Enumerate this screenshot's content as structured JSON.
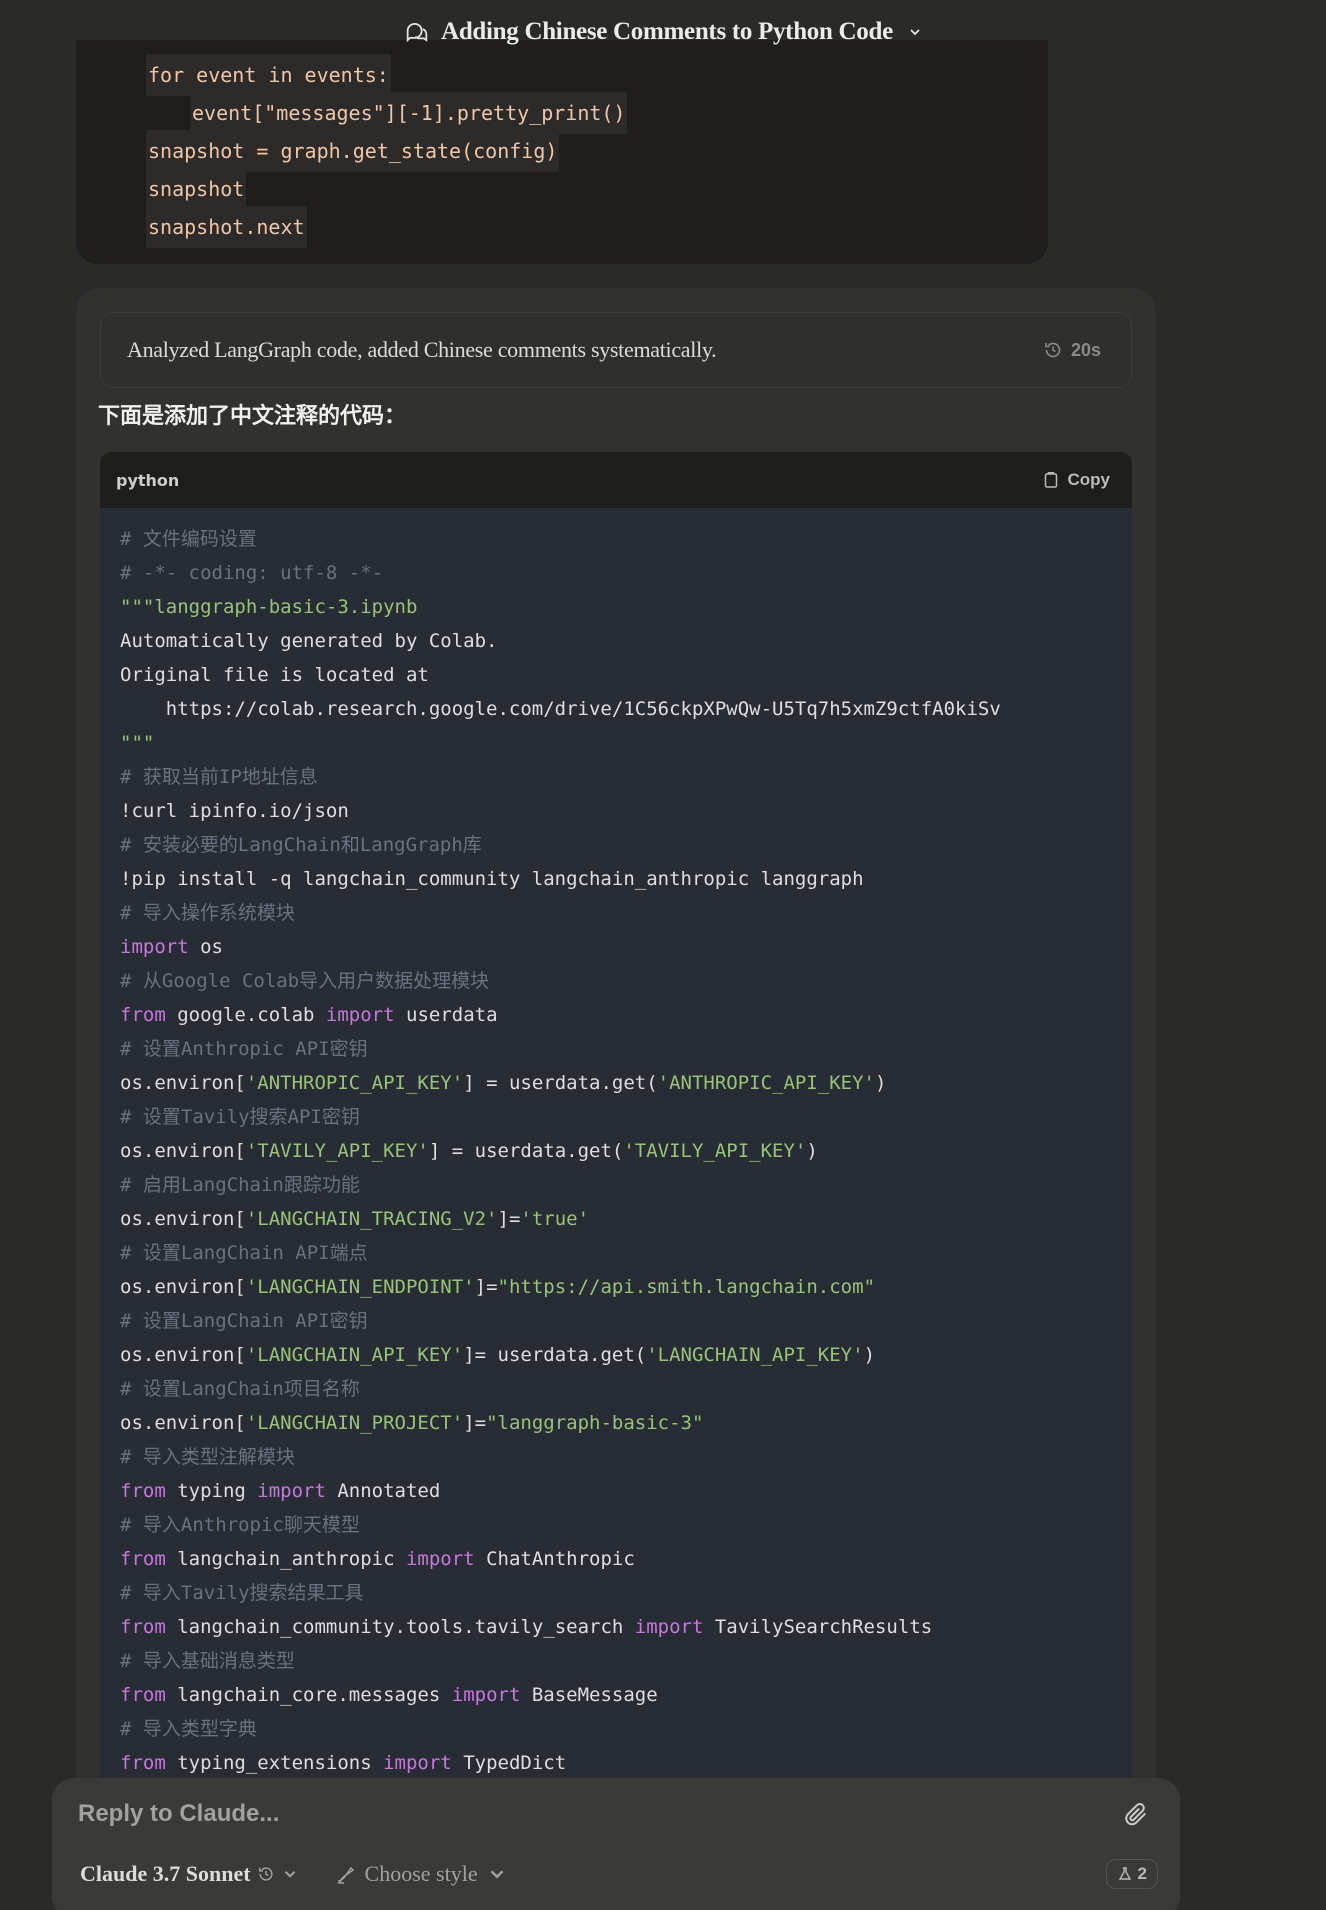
{
  "header": {
    "title": "Adding Chinese Comments to Python Code"
  },
  "previous_code": {
    "lines": [
      {
        "text": "for event in events:",
        "indent": 0
      },
      {
        "text": "event[\"messages\"][-1].pretty_print()",
        "indent": 1
      },
      {
        "text": "snapshot = graph.get_state(config)",
        "indent": 0
      },
      {
        "text": "snapshot",
        "indent": 0
      },
      {
        "text": "snapshot.next",
        "indent": 0
      }
    ]
  },
  "assistant": {
    "thinking_summary": "Analyzed LangGraph code, added Chinese comments systematically.",
    "thinking_duration": "20s",
    "intro": "下面是添加了中文注释的代码：",
    "code": {
      "language": "python",
      "copy_label": "Copy",
      "lines": [
        [
          {
            "t": "# 文件编码设置",
            "c": "com"
          }
        ],
        [
          {
            "t": "# -*- coding: utf-8 -*-",
            "c": "com"
          }
        ],
        [
          {
            "t": "\"\"\"langgraph-basic-3.ipynb",
            "c": "str"
          }
        ],
        [
          {
            "t": "Automatically generated by Colab.",
            "c": "def"
          }
        ],
        [
          {
            "t": "Original file is located at",
            "c": "def"
          }
        ],
        [
          {
            "t": "    https://colab.research.google.com/drive/1C56ckpXPwQw-U5Tq7h5xmZ9ctfA0kiSv",
            "c": "def"
          }
        ],
        [
          {
            "t": "\"\"\"",
            "c": "str"
          }
        ],
        [
          {
            "t": "# 获取当前IP地址信息",
            "c": "com"
          }
        ],
        [
          {
            "t": "!curl ipinfo.io/json",
            "c": "def"
          }
        ],
        [
          {
            "t": "# 安装必要的LangChain和LangGraph库",
            "c": "com"
          }
        ],
        [
          {
            "t": "!pip install -q langchain_community langchain_anthropic langgraph",
            "c": "def"
          }
        ],
        [
          {
            "t": "# 导入操作系统模块",
            "c": "com"
          }
        ],
        [
          {
            "t": "import",
            "c": "kw"
          },
          {
            "t": " os",
            "c": "def"
          }
        ],
        [
          {
            "t": "# 从Google Colab导入用户数据处理模块",
            "c": "com"
          }
        ],
        [
          {
            "t": "from",
            "c": "kw"
          },
          {
            "t": " google.colab ",
            "c": "def"
          },
          {
            "t": "import",
            "c": "kw"
          },
          {
            "t": " userdata",
            "c": "def"
          }
        ],
        [
          {
            "t": "# 设置Anthropic API密钥",
            "c": "com"
          }
        ],
        [
          {
            "t": "os.environ[",
            "c": "def"
          },
          {
            "t": "'ANTHROPIC_API_KEY'",
            "c": "str"
          },
          {
            "t": "] = userdata.get(",
            "c": "def"
          },
          {
            "t": "'ANTHROPIC_API_KEY'",
            "c": "str"
          },
          {
            "t": ")",
            "c": "def"
          }
        ],
        [
          {
            "t": "# 设置Tavily搜索API密钥",
            "c": "com"
          }
        ],
        [
          {
            "t": "os.environ[",
            "c": "def"
          },
          {
            "t": "'TAVILY_API_KEY'",
            "c": "str"
          },
          {
            "t": "] = userdata.get(",
            "c": "def"
          },
          {
            "t": "'TAVILY_API_KEY'",
            "c": "str"
          },
          {
            "t": ")",
            "c": "def"
          }
        ],
        [
          {
            "t": "# 启用LangChain跟踪功能",
            "c": "com"
          }
        ],
        [
          {
            "t": "os.environ[",
            "c": "def"
          },
          {
            "t": "'LANGCHAIN_TRACING_V2'",
            "c": "str"
          },
          {
            "t": "]=",
            "c": "def"
          },
          {
            "t": "'true'",
            "c": "str"
          }
        ],
        [
          {
            "t": "# 设置LangChain API端点",
            "c": "com"
          }
        ],
        [
          {
            "t": "os.environ[",
            "c": "def"
          },
          {
            "t": "'LANGCHAIN_ENDPOINT'",
            "c": "str"
          },
          {
            "t": "]=",
            "c": "def"
          },
          {
            "t": "\"https://api.smith.langchain.com\"",
            "c": "str"
          }
        ],
        [
          {
            "t": "# 设置LangChain API密钥",
            "c": "com"
          }
        ],
        [
          {
            "t": "os.environ[",
            "c": "def"
          },
          {
            "t": "'LANGCHAIN_API_KEY'",
            "c": "str"
          },
          {
            "t": "]= userdata.get(",
            "c": "def"
          },
          {
            "t": "'LANGCHAIN_API_KEY'",
            "c": "str"
          },
          {
            "t": ")",
            "c": "def"
          }
        ],
        [
          {
            "t": "# 设置LangChain项目名称",
            "c": "com"
          }
        ],
        [
          {
            "t": "os.environ[",
            "c": "def"
          },
          {
            "t": "'LANGCHAIN_PROJECT'",
            "c": "str"
          },
          {
            "t": "]=",
            "c": "def"
          },
          {
            "t": "\"langgraph-basic-3\"",
            "c": "str"
          }
        ],
        [
          {
            "t": "# 导入类型注解模块",
            "c": "com"
          }
        ],
        [
          {
            "t": "from",
            "c": "kw"
          },
          {
            "t": " typing ",
            "c": "def"
          },
          {
            "t": "import",
            "c": "kw"
          },
          {
            "t": " Annotated",
            "c": "def"
          }
        ],
        [
          {
            "t": "# 导入Anthropic聊天模型",
            "c": "com"
          }
        ],
        [
          {
            "t": "from",
            "c": "kw"
          },
          {
            "t": " langchain_anthropic ",
            "c": "def"
          },
          {
            "t": "import",
            "c": "kw"
          },
          {
            "t": " ChatAnthropic",
            "c": "def"
          }
        ],
        [
          {
            "t": "# 导入Tavily搜索结果工具",
            "c": "com"
          }
        ],
        [
          {
            "t": "from",
            "c": "kw"
          },
          {
            "t": " langchain_community.tools.tavily_search ",
            "c": "def"
          },
          {
            "t": "import",
            "c": "kw"
          },
          {
            "t": " TavilySearchResults",
            "c": "def"
          }
        ],
        [
          {
            "t": "# 导入基础消息类型",
            "c": "com"
          }
        ],
        [
          {
            "t": "from",
            "c": "kw"
          },
          {
            "t": " langchain_core.messages ",
            "c": "def"
          },
          {
            "t": "import",
            "c": "kw"
          },
          {
            "t": " BaseMessage",
            "c": "def"
          }
        ],
        [
          {
            "t": "# 导入类型字典",
            "c": "com"
          }
        ],
        [
          {
            "t": "from",
            "c": "kw"
          },
          {
            "t": " typing_extensions ",
            "c": "def"
          },
          {
            "t": "import",
            "c": "kw"
          },
          {
            "t": " TypedDict",
            "c": "def"
          }
        ]
      ]
    }
  },
  "composer": {
    "placeholder": "Reply to Claude...",
    "model_label": "Claude 3.7 Sonnet",
    "style_label": "Choose style",
    "badge_count": "2"
  }
}
